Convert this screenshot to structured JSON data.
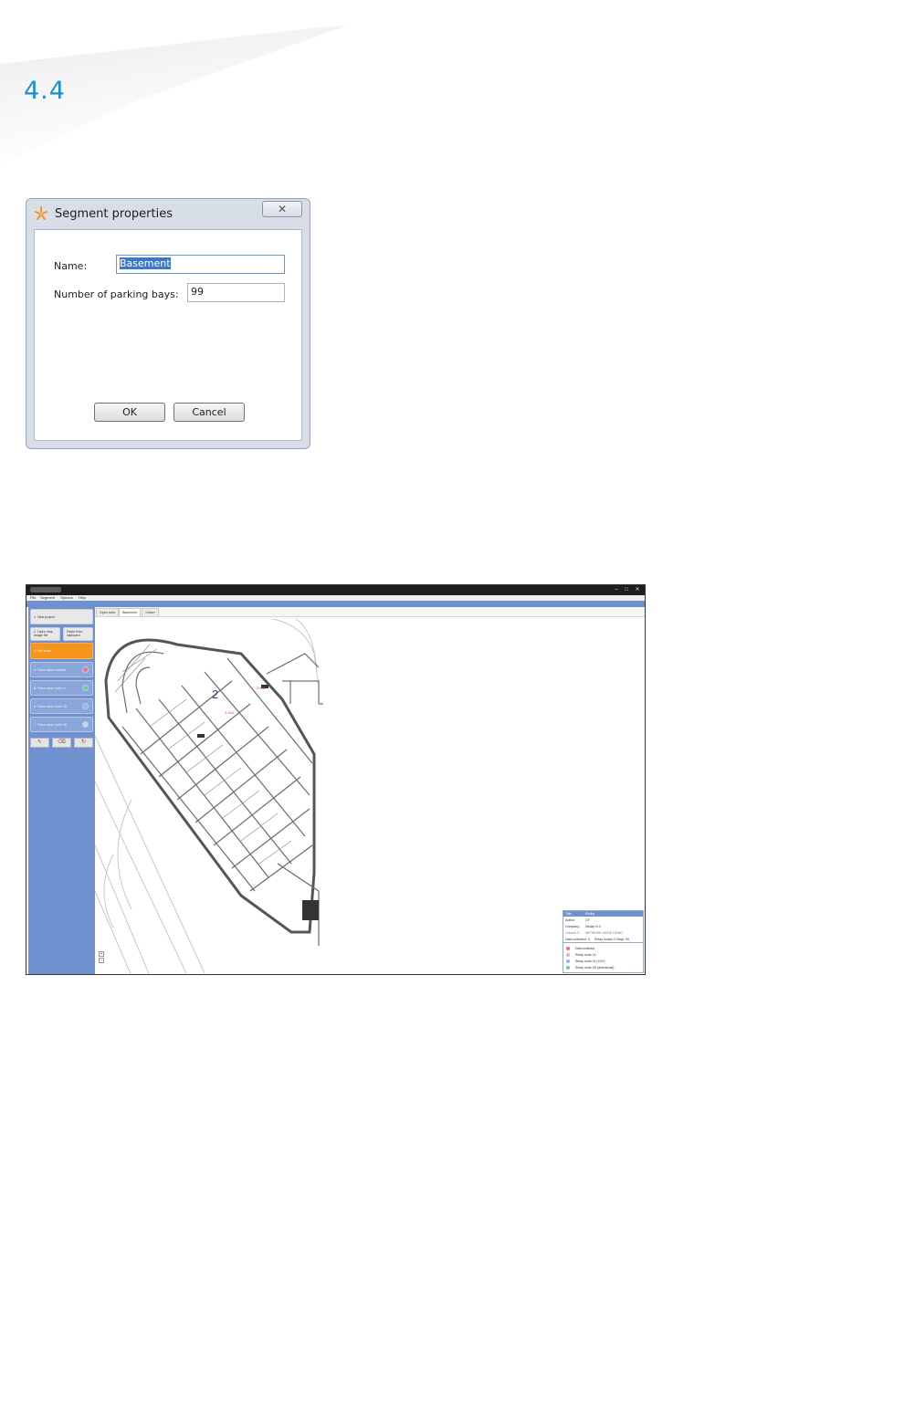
{
  "section_number": "4.4",
  "dialog": {
    "title": "Segment properties",
    "close_glyph": "✕",
    "name_label": "Name:",
    "name_value": "Basement",
    "bays_label": "Number of parking bays:",
    "bays_value": "99",
    "ok_label": "OK",
    "cancel_label": "Cancel"
  },
  "app": {
    "title": "",
    "menu": [
      "File",
      "Segment",
      "Options",
      "Help"
    ],
    "steps": [
      {
        "label": "1. New project",
        "state": "light"
      },
      {
        "label": "2. Open map image file",
        "state": "light"
      },
      {
        "label": "Paste from clipboard",
        "state": "light"
      },
      {
        "label": "3. Set scale",
        "state": "active"
      },
      {
        "label": "4. Place data collector",
        "state": "normal",
        "icon_color": "#f26b8a"
      },
      {
        "label": "5. Place relay node 1x",
        "state": "normal",
        "icon_color": "#6bd08e"
      },
      {
        "label": "6. Place relay node 3D",
        "state": "normal",
        "icon_color": "#8fb3ff"
      },
      {
        "label": "7. Place relay node 3D",
        "state": "normal",
        "icon_color": "#c7d0e6"
      }
    ],
    "tools": [
      "pointer-icon",
      "eraser-icon",
      "rotate-icon"
    ],
    "tabs": [
      "Open area",
      "Basement",
      "<New>"
    ],
    "active_tab": "Basement",
    "map": {
      "segment_number": "2",
      "red_labels": [
        "2-401",
        "2-402"
      ]
    },
    "legend": {
      "title_label": "Title:",
      "title_value": "Rodby",
      "rows": [
        {
          "k": "Author:",
          "v": "OT"
        },
        {
          "k": "Company:",
          "v": "Nedap N.V."
        },
        {
          "k": "Column 3:",
          "v": "NETWORK MODE DEMO"
        },
        {
          "k": "Data collectors: 0",
          "v": "Relay nodes: 0   Bays: 99"
        }
      ],
      "items": [
        {
          "label": "Data collector",
          "color": "#f26b8a"
        },
        {
          "label": "Relay node 1x",
          "color": "#f5a6b5"
        },
        {
          "label": "Relay node 2x (XXX)",
          "color": "#8fb3ff"
        },
        {
          "label": "Relay node 3D (directional)",
          "color": "#6bd08e"
        }
      ]
    },
    "zoom": [
      "+",
      "−"
    ]
  },
  "colors": {
    "accent_blue": "#1b8fce",
    "sidebar_blue": "#6f91cf",
    "active_orange": "#f7941d"
  }
}
